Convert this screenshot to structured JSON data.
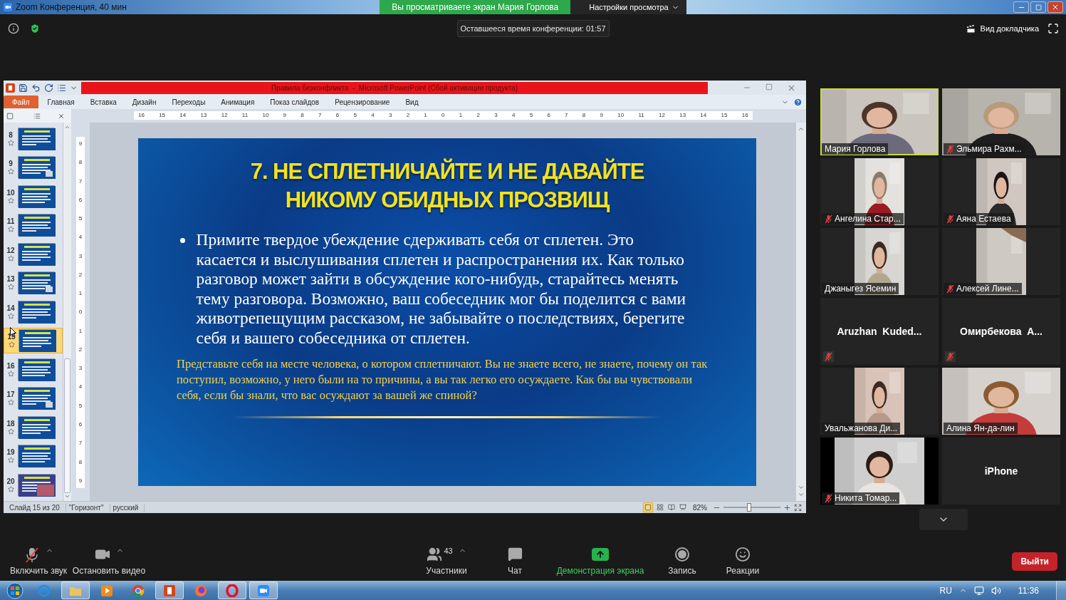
{
  "window": {
    "title": "Zoom Конференция, 40 мин"
  },
  "share_banner": {
    "text": "Вы просматриваете экран Мария Горлова",
    "view_options": "Настройки просмотра"
  },
  "meeting_bar": {
    "time_left": "Оставшееся время конференции: 01:57",
    "view_button": "Вид докладчика"
  },
  "powerpoint": {
    "title": "Правила безконфликта  -  Microsoft PowerPoint (Сбой активации продукта)",
    "tabs": [
      {
        "label": "Файл",
        "selected": true
      },
      {
        "label": "Главная",
        "selected": false
      },
      {
        "label": "Вставка",
        "selected": false
      },
      {
        "label": "Дизайн",
        "selected": false
      },
      {
        "label": "Переходы",
        "selected": false
      },
      {
        "label": "Анимация",
        "selected": false
      },
      {
        "label": "Показ слайдов",
        "selected": false
      },
      {
        "label": "Рецензирование",
        "selected": false
      },
      {
        "label": "Вид",
        "selected": false
      }
    ],
    "ruler_h": [
      "16",
      "15",
      "14",
      "13",
      "12",
      "11",
      "10",
      "9",
      "8",
      "7",
      "6",
      "5",
      "4",
      "3",
      "2",
      "1",
      "0",
      "1",
      "2",
      "3",
      "4",
      "5",
      "6",
      "7",
      "8",
      "9",
      "10",
      "11",
      "12",
      "13",
      "14",
      "15",
      "16"
    ],
    "ruler_v": [
      "9",
      "8",
      "7",
      "6",
      "5",
      "4",
      "3",
      "2",
      "1",
      "0",
      "1",
      "2",
      "3",
      "4",
      "5",
      "6",
      "7",
      "8",
      "9"
    ],
    "thumbnails": [
      {
        "number": "8",
        "selected": false
      },
      {
        "number": "9",
        "selected": false
      },
      {
        "number": "10",
        "selected": false
      },
      {
        "number": "11",
        "selected": false
      },
      {
        "number": "12",
        "selected": false
      },
      {
        "number": "13",
        "selected": false
      },
      {
        "number": "14",
        "selected": false
      },
      {
        "number": "15",
        "selected": true
      },
      {
        "number": "16",
        "selected": false
      },
      {
        "number": "17",
        "selected": false
      },
      {
        "number": "18",
        "selected": false
      },
      {
        "number": "19",
        "selected": false
      },
      {
        "number": "20",
        "selected": false
      }
    ],
    "slide": {
      "title_lines": [
        "7. НЕ СПЛЕТНИЧАЙТЕ И НЕ ДАВАЙТЕ",
        "НИКОМУ ОБИДНЫХ ПРОЗВИЩ"
      ],
      "bullet": "Примите твердое убеждение сдерживать себя от сплетен. Это касается и выслушивания сплетен и распространения их. Как только разговор может зайти в обсуждение кого-нибудь, старайтесь менять тему разговора. Возможно, ваш собеседник мог бы поделится с вами животрепещущим рассказом, не забывайте о последствиях, берегите себя и вашего собеседника от сплетен.",
      "note": "Представьте себя на месте человека, о котором сплетничают. Вы не знаете всего, не знаете, почему он так поступил, возможно, у него были на то причины, а вы так легко его осуждаете. Как бы вы чувствовали себя, если бы знали, что вас осуждают за вашей же спиной?"
    },
    "status": [
      "Слайд 15 из 20",
      "\"Горизонт\"",
      "русский"
    ],
    "zoom": {
      "reading": "82%",
      "level": 0.45
    }
  },
  "participants": [
    {
      "name": "Мария Горлова",
      "kind": "wide",
      "muted": false,
      "speaking": true
    },
    {
      "name": "Эльмира Рахм...",
      "kind": "wide",
      "muted": true,
      "speaking": false
    },
    {
      "name": "Ангелина Стар...",
      "kind": "portrait",
      "muted": true,
      "speaking": false
    },
    {
      "name": "Аяна Естаева",
      "kind": "portrait",
      "muted": true,
      "speaking": false
    },
    {
      "name": "Джаныгез Ясемин",
      "kind": "portrait",
      "muted": false,
      "speaking": false
    },
    {
      "name": "Алексей Лине...",
      "kind": "portrait",
      "muted": true,
      "speaking": false
    },
    {
      "name": "Aruzhan  Kuded...",
      "kind": "none",
      "muted": true,
      "speaking": false
    },
    {
      "name": "Омирбекова  А...",
      "kind": "none",
      "muted": true,
      "speaking": false
    },
    {
      "name": "Увальжанова Ди...",
      "kind": "portrait",
      "muted": false,
      "speaking": false
    },
    {
      "name": "Алина Ян-да-лин",
      "kind": "wide",
      "muted": false,
      "speaking": false
    },
    {
      "name": "Никита Томар...",
      "kind": "boxed",
      "muted": true,
      "speaking": false
    },
    {
      "name": "iPhone",
      "kind": "none",
      "muted": false,
      "speaking": false
    }
  ],
  "toolbar": [
    {
      "kind": "mic",
      "label": "Включить звук",
      "muted": true
    },
    {
      "kind": "video",
      "label": "Остановить видео"
    },
    {
      "kind": "participants",
      "label": "Участники",
      "count": "43"
    },
    {
      "kind": "chat",
      "label": "Чат"
    },
    {
      "kind": "share",
      "label": "Демонстрация экрана"
    },
    {
      "kind": "record",
      "label": "Запись"
    },
    {
      "kind": "reactions",
      "label": "Реакции"
    }
  ],
  "leave_button": "Выйти",
  "taskbar": {
    "language": "RU",
    "time": "11:36"
  }
}
